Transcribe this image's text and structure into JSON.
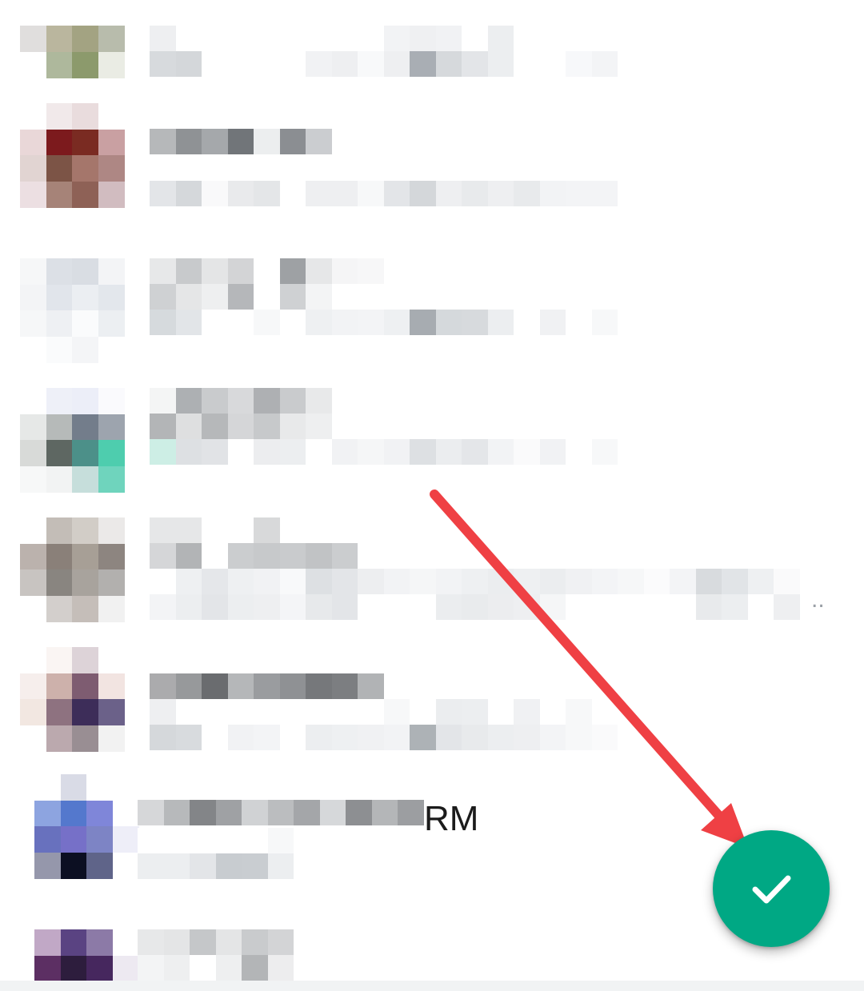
{
  "contacts": [
    {
      "avatar_colors": [
        [
          "#e0dedd",
          "#bab69e",
          "#a3a382",
          "#b8bcac"
        ],
        [
          "#ffffff",
          "#aeb89c",
          "#8c9a6c",
          "#eaece4"
        ]
      ],
      "lines": [
        [
          "#eeeff1",
          "#ffffff",
          "#ffffff",
          "#ffffff",
          "#ffffff",
          "#ffffff",
          "#ffffff",
          "#ffffff",
          "#ffffff",
          "#f2f3f5",
          "#eff0f2",
          "#f1f2f4",
          "#ffffff",
          "#eceef0"
        ],
        [
          "#d7dadd",
          "#d4d7da",
          "#ffffff",
          "#ffffff",
          "#ffffff",
          "#ffffff",
          "#f1f2f4",
          "#eeeff1",
          "#f8f9fa",
          "#eeeff1",
          "#a9aeb4",
          "#d6d9dc",
          "#e3e5e8",
          "#eceef0",
          "#ffffff",
          "#ffffff",
          "#f7f8fa",
          "#f3f4f6"
        ]
      ]
    },
    {
      "avatar_colors": [
        [
          "#ffffff",
          "#f1e9ea",
          "#e9dcdd",
          "#ffffff"
        ],
        [
          "#e9d7d8",
          "#7c1a1d",
          "#7a2b22",
          "#c9a0a2"
        ],
        [
          "#e1d4d2",
          "#7c5446",
          "#a5766b",
          "#ae8784"
        ],
        [
          "#ecdfe2",
          "#a68378",
          "#8e6156",
          "#d1bcc0"
        ]
      ],
      "lines": [
        [
          "#b6b8ba",
          "#8f9295",
          "#a5a8ab",
          "#717579",
          "#eceeef",
          "#8b8e92",
          "#cbcdd0"
        ],
        [
          "#e3e5e8",
          "#d5d8db",
          "#f9f9fa",
          "#e9eaec",
          "#e4e6e8",
          "#ffffff",
          "#eeeff1",
          "#eeeff1",
          "#f7f8f9",
          "#e3e5e8",
          "#d4d7da",
          "#eeeff1",
          "#e8eaec",
          "#eeeff1",
          "#e8eaec",
          "#f2f3f5",
          "#f3f4f6",
          "#f3f4f6"
        ]
      ]
    },
    {
      "avatar_colors": [
        [
          "#f6f7f8",
          "#dce0e6",
          "#d9dde3",
          "#f3f4f6"
        ],
        [
          "#f3f4f6",
          "#e1e5eb",
          "#ebeef2",
          "#e3e7ec"
        ],
        [
          "#f6f7f8",
          "#eef0f3",
          "#fafbfc",
          "#eceff2"
        ],
        [
          "#ffffff",
          "#fafbfc",
          "#f4f5f7",
          "#ffffff"
        ]
      ],
      "lines": [
        [
          "#e7e8e9",
          "#c8cacc",
          "#e4e5e6",
          "#d3d4d6",
          "#ffffff",
          "#9ea1a4",
          "#e6e7e8",
          "#f5f5f6",
          "#f7f7f8"
        ],
        [
          "#cfd1d3",
          "#e5e6e7",
          "#eeeff0",
          "#b5b7ba",
          "#ffffff",
          "#cfd1d3",
          "#f3f4f5",
          "#ffffff",
          "#ffffff"
        ],
        [
          "#d6dadd",
          "#e2e5e8",
          "#ffffff",
          "#ffffff",
          "#f7f8f9",
          "#ffffff",
          "#eef0f2",
          "#f2f3f5",
          "#f3f4f6",
          "#eef0f2",
          "#a7acb1",
          "#d5d9dc",
          "#d7dadd",
          "#eceef0",
          "#ffffff",
          "#f0f1f3",
          "#ffffff",
          "#f7f8f9"
        ]
      ]
    },
    {
      "avatar_colors": [
        [
          "#ffffff",
          "#eef0f8",
          "#eceef8",
          "#fafafd"
        ],
        [
          "#e6e8e7",
          "#b6bab9",
          "#737d8b",
          "#9da4ae"
        ],
        [
          "#d8dad8",
          "#5e6762",
          "#4c9089",
          "#4ecdae"
        ],
        [
          "#f7f8f8",
          "#f2f3f3",
          "#c6dedb",
          "#6fd4bd"
        ]
      ],
      "lines": [
        [
          "#f4f5f5",
          "#adb0b3",
          "#c9cbcd",
          "#d8d9db",
          "#aeb0b3",
          "#c9cbcd",
          "#e8e9ea"
        ],
        [
          "#b3b5b7",
          "#dedfe0",
          "#b6b8ba",
          "#d5d6d8",
          "#c7c9cb",
          "#e8e9ea",
          "#eeeff0"
        ],
        [
          "#cdeee5",
          "#dde0e3",
          "#e1e3e6",
          "#ffffff",
          "#ecedef",
          "#eceef0",
          "#ffffff",
          "#f1f2f4",
          "#f5f6f7",
          "#f1f2f4",
          "#dde0e3",
          "#ebedef",
          "#e4e6e9",
          "#f2f3f5",
          "#fafafb",
          "#f1f2f4",
          "#ffffff",
          "#f7f8f9"
        ]
      ]
    },
    {
      "avatar_colors": [
        [
          "#ffffff",
          "#c3bdb7",
          "#d2cdc7",
          "#ebe9e8"
        ],
        [
          "#bbb2ad",
          "#8a8079",
          "#a79f96",
          "#8d8580"
        ],
        [
          "#c8c4c1",
          "#898580",
          "#a8a39d",
          "#b2b0ae"
        ],
        [
          "#ffffff",
          "#d3cfcc",
          "#c5beb9",
          "#f1f1f1"
        ]
      ],
      "lines": [
        [
          "#e6e7e8",
          "#e6e7e8",
          "#ffffff",
          "#ffffff",
          "#d8d9da"
        ],
        [
          "#d5d6d8",
          "#b2b4b6",
          "#ffffff",
          "#cbcdcf",
          "#c7c9cb",
          "#c9cbcd",
          "#c1c3c5",
          "#cbcdcf"
        ],
        [
          "#ffffff",
          "#eef0f2",
          "#e5e7ea",
          "#eef0f2",
          "#f1f2f4",
          "#f8f9fa",
          "#dde0e3",
          "#e3e5e8",
          "#edeef0",
          "#f2f3f5",
          "#f5f6f7",
          "#f2f3f5",
          "#eef0f2",
          "#ebedef",
          "#eef0f2",
          "#ebedef",
          "#f0f1f3",
          "#f3f4f6",
          "#f6f7f8",
          "#fbfbfc",
          "#f3f4f6",
          "#d8dbde",
          "#e1e4e7",
          "#eef0f2",
          "#fafafb"
        ],
        [
          "#f3f4f6",
          "#eceef0",
          "#e3e5e8",
          "#eceef0",
          "#eeeff1",
          "#f4f5f7",
          "#e7e9eb",
          "#e3e5e8",
          "#ffffff",
          "#ffffff",
          "#ffffff",
          "#ebedef",
          "#e9ebed",
          "#ecedef",
          "#eeeff1",
          "#f5f6f7",
          "#ffffff",
          "#ffffff",
          "#ffffff",
          "#ffffff",
          "#ffffff",
          "#e8eaec",
          "#eceef0",
          "#ffffff",
          "#eeeff1"
        ]
      ],
      "ellipsis": ".."
    },
    {
      "avatar_colors": [
        [
          "#ffffff",
          "#faf5f3",
          "#ddd3d8",
          "#ffffff"
        ],
        [
          "#f6eeec",
          "#cdb1ab",
          "#7e5c71",
          "#f2e4e1"
        ],
        [
          "#f2e7e1",
          "#8e7280",
          "#3d2d59",
          "#6b6189"
        ],
        [
          "#ffffff",
          "#bba9ae",
          "#998e93",
          "#f2f2f2"
        ]
      ],
      "lines": [
        [
          "#ababad",
          "#97999b",
          "#6a6c6f",
          "#b5b7b9",
          "#9a9c9f",
          "#8f9194",
          "#76787b",
          "#7c7e81",
          "#b1b3b5"
        ],
        [
          "#eeeff1",
          "#ffffff",
          "#ffffff",
          "#ffffff",
          "#ffffff",
          "#ffffff",
          "#ffffff",
          "#ffffff",
          "#ffffff",
          "#f7f8f9",
          "#ffffff",
          "#ebedef",
          "#eceef0",
          "#ffffff",
          "#f0f1f3",
          "#ffffff",
          "#f7f8f9"
        ],
        [
          "#d5d8db",
          "#d8dbde",
          "#ffffff",
          "#f1f2f4",
          "#f3f4f6",
          "#ffffff",
          "#eceef0",
          "#eef0f2",
          "#f0f1f3",
          "#f2f3f5",
          "#adb2b6",
          "#e3e5e8",
          "#e8eaec",
          "#eceef0",
          "#eeeff1",
          "#f3f4f6",
          "#f7f8f9",
          "#fafafb"
        ]
      ]
    },
    {
      "avatar_colors": [
        [
          "#ffffff",
          "#d9dbe6",
          "#ffffff",
          "#ffffff"
        ],
        [
          "#8da4e0",
          "#5478cd",
          "#7f86d9",
          "#ffffff"
        ],
        [
          "#6871be",
          "#7670c8",
          "#7d84c5",
          "#eeeef8"
        ],
        [
          "#9597ab",
          "#0c0f22",
          "#5f6489",
          "#ffffff"
        ]
      ],
      "name_suffix": "RM",
      "lines": [
        [
          "#d6d7d9",
          "#b7b9bb",
          "#838588",
          "#9fa1a4",
          "#d0d2d4",
          "#bbbdbf",
          "#a4a6a9",
          "#d6d8da",
          "#8d8f92",
          "#b4b6b8",
          "#9c9ea1"
        ],
        [
          "#ffffff",
          "#ffffff",
          "#ffffff",
          "#ffffff",
          "#ffffff",
          "#f7f8f9"
        ],
        [
          "#eceef0",
          "#eceef0",
          "#e3e5e8",
          "#c8ccd0",
          "#c9cdd1",
          "#eceef0"
        ]
      ]
    },
    {
      "avatar_colors": [
        [
          "#c1a8c6",
          "#5a4382",
          "#8c7aa7",
          "#ffffff"
        ],
        [
          "#5c2f63",
          "#2d1d3d",
          "#46275e",
          "#ede9f1"
        ],
        [
          "#c1469e",
          "#8a2780",
          "#b64a9a",
          "#ffffff"
        ]
      ],
      "lines": [
        [
          "#e7e8e9",
          "#e4e5e6",
          "#c5c7c9",
          "#e4e5e6",
          "#c9cbcd",
          "#d3d4d6"
        ],
        [
          "#f3f4f5",
          "#eeeff0",
          "#ffffff",
          "#eeeff0",
          "#b3b5b7",
          "#ededee"
        ]
      ]
    }
  ],
  "fab": {
    "icon": "checkmark-icon",
    "color": "#00a884"
  },
  "annotation": {
    "type": "arrow",
    "color": "#ef4044"
  }
}
